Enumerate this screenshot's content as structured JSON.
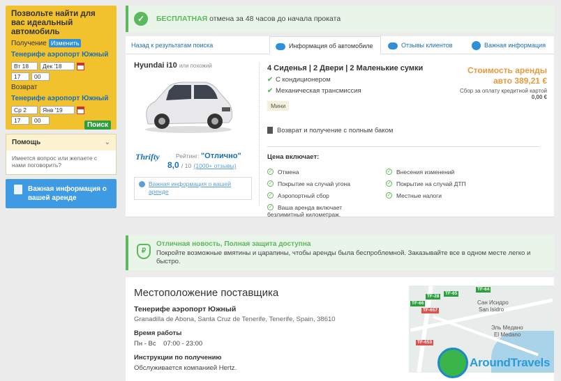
{
  "sidebar": {
    "search_title": "Позвольте найти для вас идеальный автомобиль",
    "pickup_label": "Получение",
    "change_label": "Изменить",
    "pickup_location": "Тенерифе аэропорт Южный",
    "pickup_day": "Вт 18",
    "pickup_month": "Дек '18",
    "pickup_hour": "17",
    "pickup_min": "00",
    "return_label": "Возврат",
    "return_location": "Тенерифе аэропорт Южный",
    "return_day": "Ср 2",
    "return_month": "Янв '19",
    "return_hour": "17",
    "return_min": "00",
    "search_button": "Поиск",
    "help_title": "Помощь",
    "help_text": "Имеется вопрос или желаете с нами поговорить?",
    "important_button": "Важная информация о вашей аренде"
  },
  "banner": {
    "free_label": "БЕСПЛАТНАЯ",
    "text": "отмена за 48 часов до начала проката"
  },
  "tabs": {
    "back": "Назад к результатам поиска",
    "car_info": "Информация об автомобиле",
    "reviews": "Отзывы клиентов",
    "important": "Важная информация"
  },
  "car": {
    "name": "Hyundai i10",
    "similar": "или похожий",
    "supplier": "Thrifty",
    "rating_label": "Рейтинг:",
    "rating_word": "\"Отлично\"",
    "rating_value": "8,0",
    "rating_max": "/ 10",
    "reviews_link": "(1000+ отзывы)",
    "important_link": "Важная информация о вашей аренде",
    "features_head": "4 Сиденья | 2 Двери | 2 Маленькие сумки",
    "feat_ac": "С кондиционером",
    "feat_trans": "Механическая трансмиссия",
    "category": "Мини",
    "fuel_policy": "Возврат и получение с полным баком",
    "price_label": "Стоимость аренды",
    "price_value": "авто 389,21 €",
    "card_fee_label": "Сбор за оплату кредитной картой",
    "card_fee_value": "0,00 €"
  },
  "included": {
    "title": "Цена включает:",
    "items": [
      "Отмена",
      "Покрытие на случай угона",
      "Аэропортный сбор",
      "Ваша аренда включает безлимитный километраж.",
      "Внесения изменений",
      "Покрытие на случай ДТП",
      "Местные налоги"
    ]
  },
  "protection": {
    "title": "Отличная новость, Полная защита доступна",
    "text": "Покройте возможные вмятины и царапины, чтобы аренды была беспроблемной. Заказывайте все в одном месте легко и быстро."
  },
  "location": {
    "title": "Местоположение поставщика",
    "name": "Тенерифе аэропорт Южный",
    "address": "Granadilla de Abona, Santa Cruz de Tenerife, Tenerife, Spain, 38610",
    "hours_label": "Время работы",
    "hours": "Пн - Вс    07:00 - 23:00",
    "instructions_label": "Инструкции по получению",
    "instructions": "Обслуживается компанией Hertz."
  },
  "map": {
    "road1": "TF-28",
    "road2": "TF-64",
    "road3": "TF-65",
    "road4": "TF-66",
    "road5": "TF-657",
    "road6": "TF-653",
    "place1": "Сан Исидро",
    "place2": "San Isidro",
    "place3": "Эль Медано",
    "place4": "El Medano"
  },
  "watermark": "AroundTravels"
}
